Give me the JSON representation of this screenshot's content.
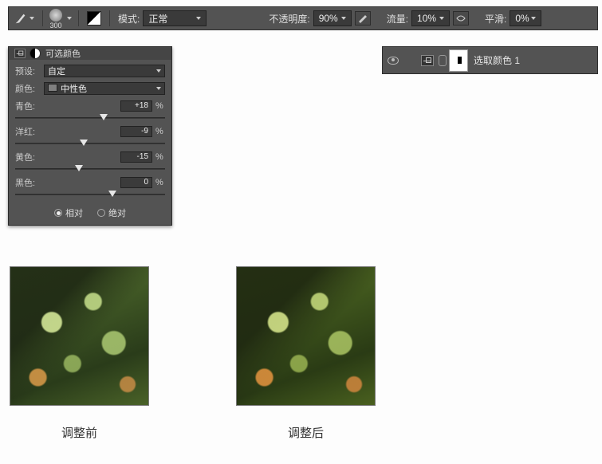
{
  "toolbar": {
    "brush_size": "300",
    "mode_label": "模式:",
    "mode_value": "正常",
    "opacity_label": "不透明度:",
    "opacity_value": "90%",
    "flow_label": "流量:",
    "flow_value": "10%",
    "smoothing_label": "平滑:",
    "smoothing_value": "0%"
  },
  "layer": {
    "name": "选取颜色 1"
  },
  "panel": {
    "title": "可选颜色",
    "preset_label": "预设:",
    "preset_value": "自定",
    "colors_label": "颜色:",
    "colors_value": "中性色",
    "sliders": [
      {
        "name": "青色:",
        "value": "+18",
        "pos": 59
      },
      {
        "name": "洋红:",
        "value": "-9",
        "pos": 45.5
      },
      {
        "name": "黄色:",
        "value": "-15",
        "pos": 42.5
      },
      {
        "name": "黑色:",
        "value": "0",
        "pos": 65
      }
    ],
    "pct": "%",
    "method": {
      "relative": "相对",
      "absolute": "绝对",
      "selected": "relative"
    }
  },
  "captions": {
    "before": "调整前",
    "after": "调整后"
  }
}
